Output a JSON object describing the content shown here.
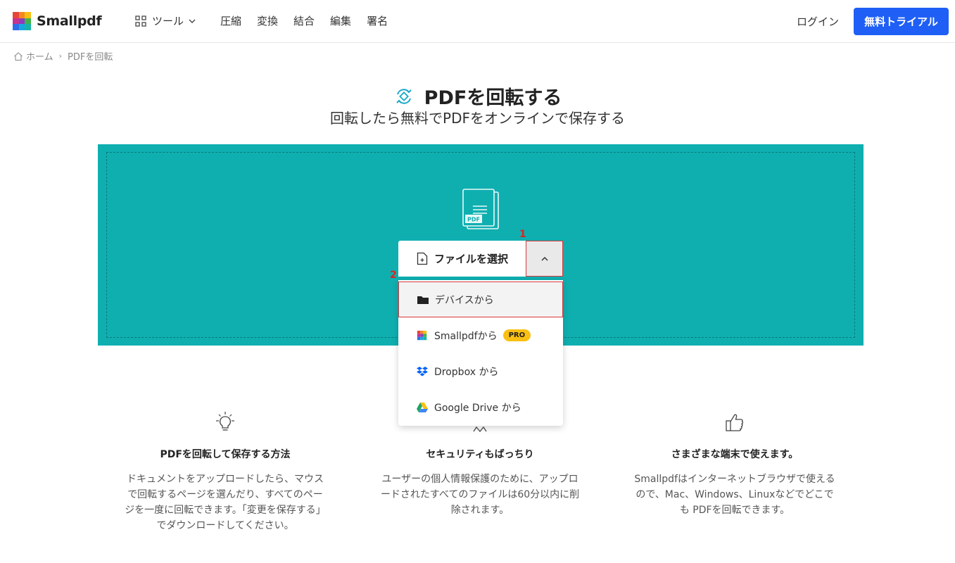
{
  "header": {
    "logo_text": "Smallpdf",
    "tools_label": "ツール",
    "nav": [
      "圧縮",
      "変換",
      "結合",
      "編集",
      "署名"
    ],
    "login_label": "ログイン",
    "trial_label": "無料トライアル"
  },
  "breadcrumb": {
    "home": "ホーム",
    "current": "PDFを回転"
  },
  "hero": {
    "title": "PDFを回転する",
    "subtitle": "回転したら無料でPDFをオンラインで保存する"
  },
  "upload": {
    "select_label": "ファイルを選択",
    "marker_1": "1",
    "marker_2": "2",
    "pdf_tag": "PDF",
    "options": [
      {
        "label": "デバイスから",
        "icon": "folder-icon"
      },
      {
        "label": "Smallpdfから",
        "icon": "smallpdf-icon",
        "badge": "PRO"
      },
      {
        "label": "Dropbox から",
        "icon": "dropbox-icon"
      },
      {
        "label": "Google Drive から",
        "icon": "google-drive-icon"
      }
    ]
  },
  "features": [
    {
      "title": "PDFを回転して保存する方法",
      "text": "ドキュメントをアップロードしたら、マウスで回転するページを選んだり、すべてのページを一度に回転できます。「変更を保存する」でダウンロードしてください。",
      "icon": "lightbulb-icon"
    },
    {
      "title": "セキュリティもばっちり",
      "text": "ユーザーの個人情報保護のために、アップロードされたすべてのファイルは60分以内に削除されます。",
      "icon": "stars-icon"
    },
    {
      "title": "さまざまな端末で使えます。",
      "text": "Smallpdfはインターネットブラウザで使えるので、Mac、Windows、Linuxなどでどこでも PDFを回転できます。",
      "icon": "thumbs-up-icon"
    }
  ],
  "colors": {
    "accent": "#1f5ff5",
    "dropzone": "#0fafb0",
    "highlight": "#d9383c",
    "pro_badge": "#f9c013"
  }
}
